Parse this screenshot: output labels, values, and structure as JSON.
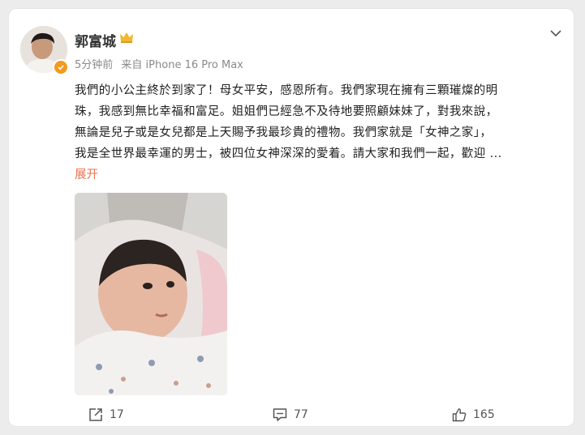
{
  "post": {
    "author_name": "郭富城",
    "meta_time": "5分钟前",
    "meta_source": "来自 iPhone 16 Pro Max",
    "text_lines": [
      "我們的小公主終於到家了！母女平安，感恩所有。我們家現在擁有三顆璀燦的明",
      "珠，我感到無比幸福和富足。姐姐們已經急不及待地要照顧妹妹了，對我來說，",
      "無論是兒子或是女兒都是上天賜予我最珍貴的禮物。我們家就是「女神之家」，",
      "我是全世界最幸運的男士，被四位女神深深的愛着。請大家和我們一起，歡迎 ..."
    ],
    "expand_label": "展开"
  },
  "actions": {
    "repost_count": "17",
    "comment_count": "77",
    "like_count": "165"
  },
  "colors": {
    "accent": "#eb7350",
    "badge": "#f39a1f"
  },
  "icons": {
    "verified": "verified-badge-icon",
    "crown": "crown-icon",
    "more": "chevron-down-icon",
    "repost": "repost-icon",
    "comment": "comment-icon",
    "like": "like-icon"
  }
}
